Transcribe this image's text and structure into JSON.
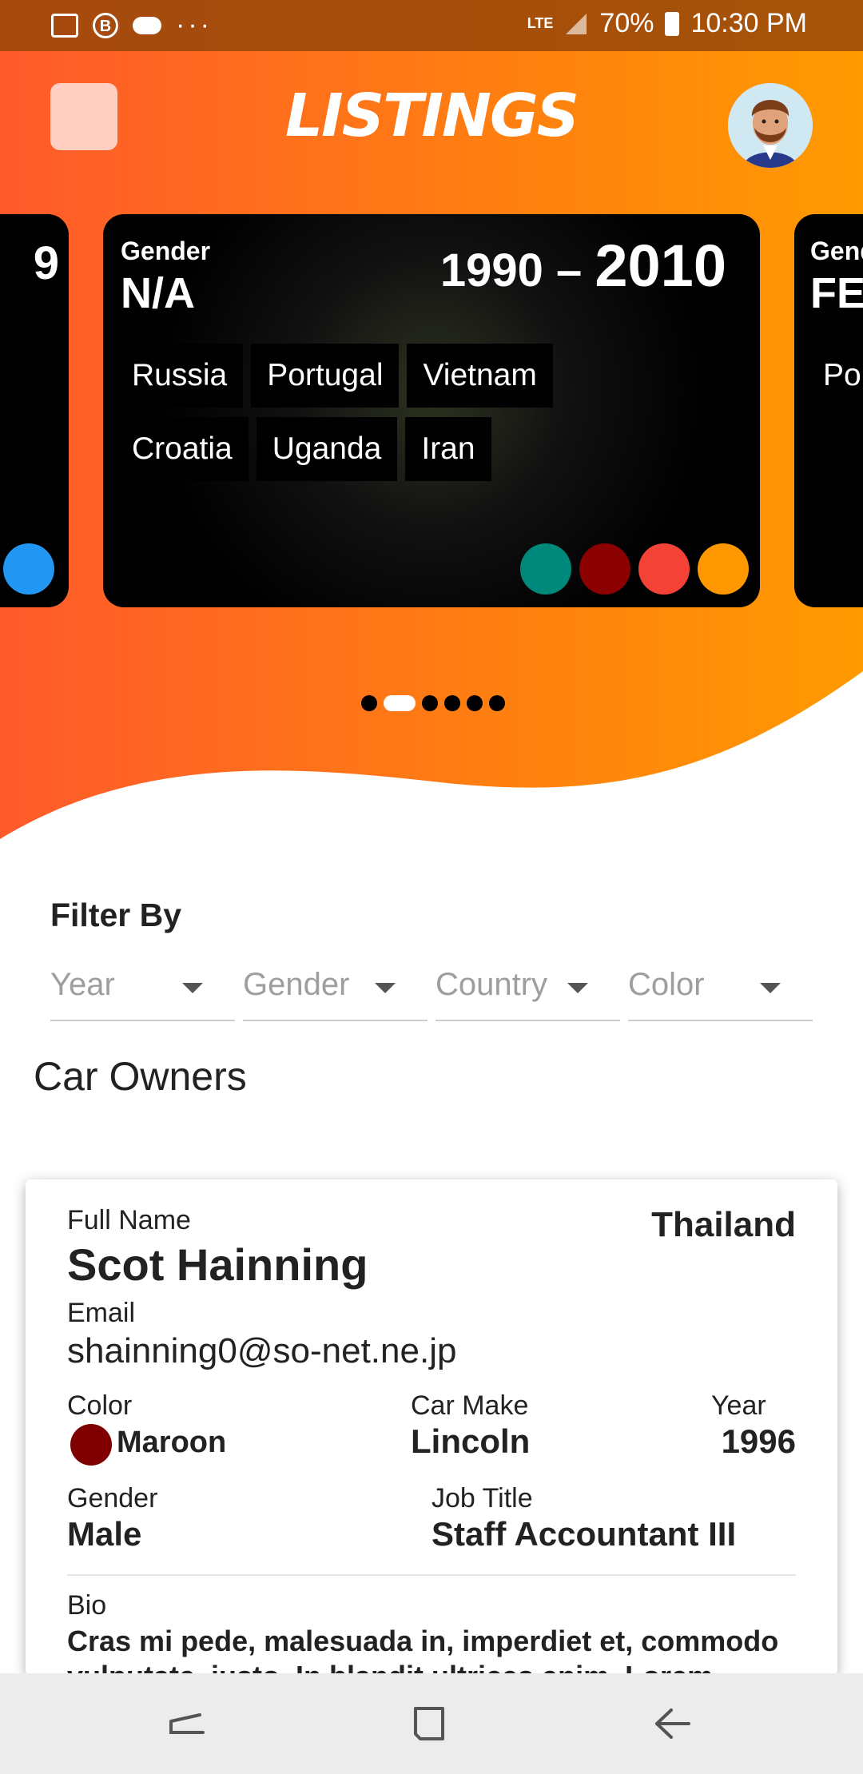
{
  "status": {
    "network": "LTE",
    "battery": "70%",
    "time": "10:30 PM",
    "more": "···"
  },
  "header": {
    "title": "LISTINGS"
  },
  "carousel": {
    "prev_card": {
      "partial_number": "9",
      "color": "#2196f3"
    },
    "current": {
      "gender_label": "Gender",
      "gender_value": "N/A",
      "year_from": "1990",
      "year_sep": "–",
      "year_to": "2010",
      "countries": [
        "Russia",
        "Portugal",
        "Vietnam",
        "Croatia",
        "Uganda",
        "Iran"
      ],
      "colors": [
        "#00897b",
        "#8b0000",
        "#f44336",
        "#ff9800"
      ]
    },
    "next_card": {
      "gender_label": "Gend",
      "gender_value": "FE",
      "country": "Po"
    },
    "page_count": 6,
    "active_page": 1
  },
  "filter": {
    "title": "Filter By",
    "fields": [
      {
        "label": "Year"
      },
      {
        "label": "Gender"
      },
      {
        "label": "Country"
      },
      {
        "label": "Color"
      }
    ]
  },
  "owners": {
    "title": "Car Owners",
    "items": [
      {
        "full_name_label": "Full Name",
        "full_name": "Scot Hainning",
        "country": "Thailand",
        "email_label": "Email",
        "email": "shainning0@so-net.ne.jp",
        "color_label": "Color",
        "color": "Maroon",
        "color_hex": "#7f0000",
        "car_make_label": "Car Make",
        "car_make": "Lincoln",
        "year_label": "Year",
        "year": "1996",
        "gender_label": "Gender",
        "gender": "Male",
        "job_label": "Job Title",
        "job": "Staff Accountant III",
        "bio_label": "Bio",
        "bio": "Cras mi pede, malesuada in, imperdiet et, commodo vulputate, justo. In blandit ultrices enim. Lorem ipsum"
      }
    ]
  }
}
